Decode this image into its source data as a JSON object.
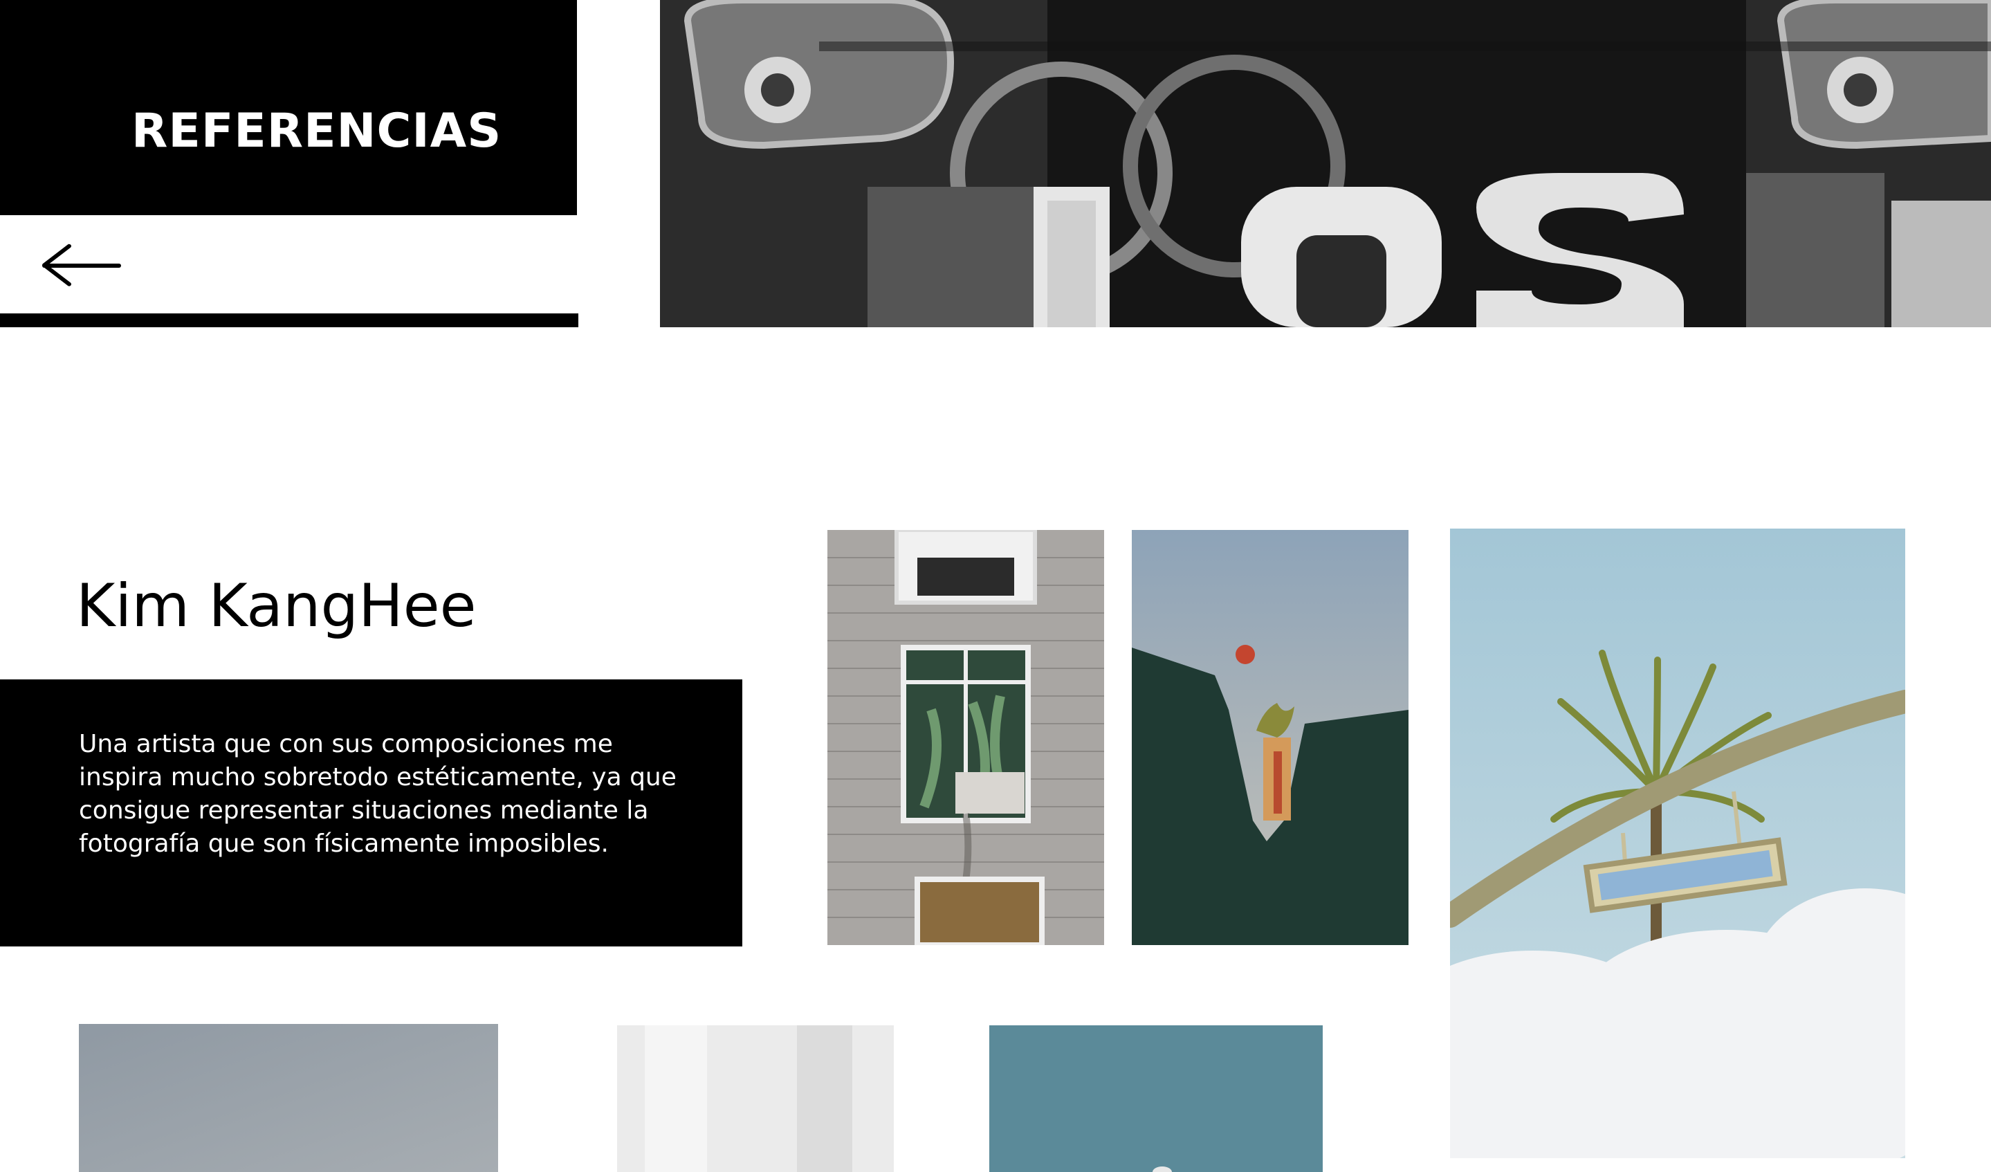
{
  "header": {
    "title": "REFERENCIAS",
    "back_icon": "arrow-left-icon"
  },
  "artist": {
    "name": "Kim KangHee",
    "description": "Una artista que con sus composiciones me inspira mucho sobretodo estéticamente, ya que consigue representar situaciones mediante la fotografía que son físicamente imposibles."
  },
  "colors": {
    "background": "#ffffff",
    "block": "#000000",
    "text_on_block": "#ffffff"
  }
}
